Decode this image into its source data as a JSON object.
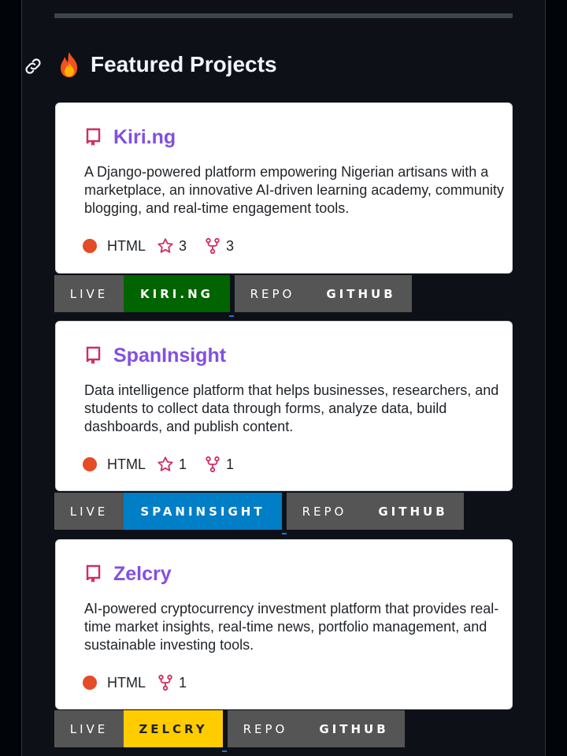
{
  "section": {
    "heading": "Featured Projects",
    "anchor_icon": "link-icon",
    "emoji_icon": "fire-icon"
  },
  "projects": [
    {
      "name": "Kiri.ng",
      "description": "A Django-powered platform empowering Nigerian artisans with a marketplace, an innovative AI-driven learning academy, community blogging, and real-time engagement tools.",
      "language": "HTML",
      "language_color": "#e34c26",
      "stars": "3",
      "forks": "3",
      "live_label": "LIVE",
      "live_value": "KIRI.NG",
      "live_color": "#006400",
      "repo_label": "REPO",
      "repo_value": "GITHUB"
    },
    {
      "name": "SpanInsight",
      "description": "Data intelligence platform that helps businesses, researchers, and students to collect data through forms, analyze data, build dashboards, and publish content.",
      "language": "HTML",
      "language_color": "#e34c26",
      "stars": "1",
      "forks": "1",
      "live_label": "LIVE",
      "live_value": "SPANINSIGHT",
      "live_color": "#007ec6",
      "repo_label": "REPO",
      "repo_value": "GITHUB"
    },
    {
      "name": "Zelcry",
      "description": "AI-powered cryptocurrency investment platform that provides real-time market insights, real-time news, portfolio management, and sustainable investing tools.",
      "language": "HTML",
      "language_color": "#e34c26",
      "forks": "1",
      "live_label": "LIVE",
      "live_value": "ZELCRY",
      "live_color": "#ffcc00",
      "repo_label": "REPO",
      "repo_value": "GITHUB"
    }
  ]
}
